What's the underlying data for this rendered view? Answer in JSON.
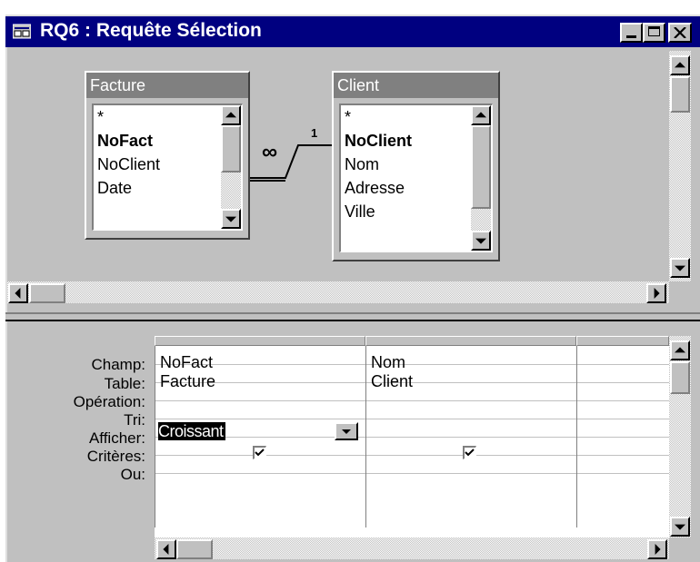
{
  "window": {
    "title": "RQ6 : Requête Sélection",
    "minimize_label": "_",
    "maximize_label": "□",
    "close_label": "✕"
  },
  "tables": [
    {
      "name": "Facture",
      "fields": [
        {
          "label": "*",
          "key": false
        },
        {
          "label": "NoFact",
          "key": true
        },
        {
          "label": "NoClient",
          "key": false
        },
        {
          "label": "Date",
          "key": false
        }
      ]
    },
    {
      "name": "Client",
      "fields": [
        {
          "label": "*",
          "key": false
        },
        {
          "label": "NoClient",
          "key": true
        },
        {
          "label": "Nom",
          "key": false
        },
        {
          "label": "Adresse",
          "key": false
        },
        {
          "label": "Ville",
          "key": false
        }
      ]
    }
  ],
  "relationship": {
    "many_symbol": "∞",
    "one_symbol": "1"
  },
  "grid": {
    "row_labels": [
      "Champ:",
      "Table:",
      "Opération:",
      "Tri:",
      "Afficher:",
      "Critères:",
      "Ou:"
    ],
    "columns": [
      {
        "champ": "NoFact",
        "table": "Facture",
        "operation": "",
        "tri": "Croissant",
        "afficher": true,
        "criteres": "",
        "ou": ""
      },
      {
        "champ": "Nom",
        "table": "Client",
        "operation": "",
        "tri": "",
        "afficher": true,
        "criteres": "",
        "ou": ""
      }
    ]
  }
}
